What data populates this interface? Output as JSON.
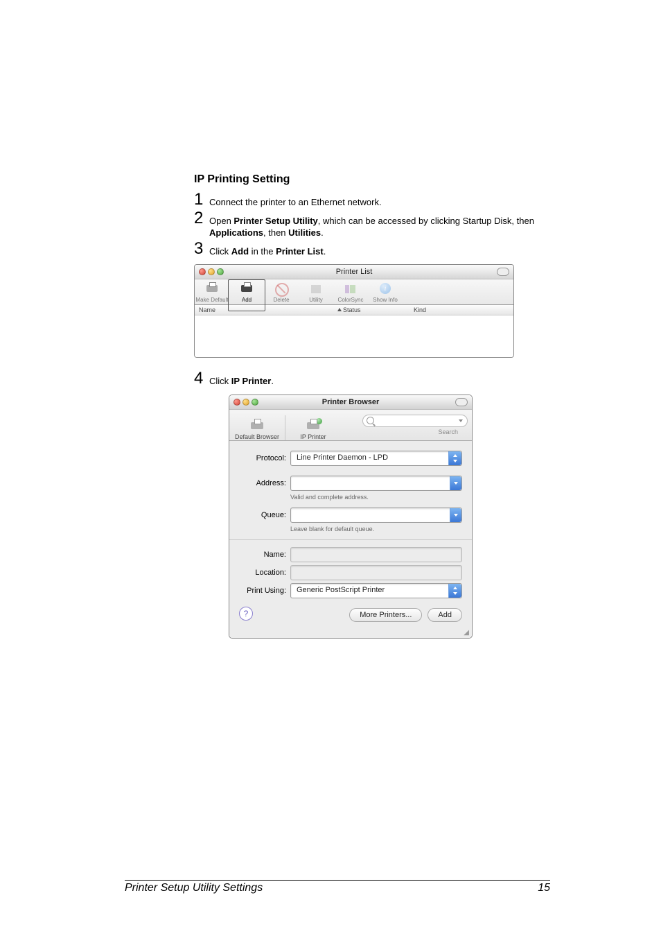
{
  "section_heading": "IP Printing Setting",
  "steps": {
    "s1": {
      "num": "1",
      "text": "Connect the printer to an Ethernet network."
    },
    "s2": {
      "num": "2",
      "prefix": "Open ",
      "b1": "Printer Setup Utility",
      "mid1": ", which can be accessed by clicking Startup Disk, then ",
      "b2": "Applications",
      "mid2": ", then ",
      "b3": "Utilities",
      "suffix": "."
    },
    "s3": {
      "num": "3",
      "prefix": "Click ",
      "b1": "Add",
      "mid1": " in the ",
      "b2": "Printer List",
      "suffix": "."
    },
    "s4": {
      "num": "4",
      "prefix": "Click ",
      "b1": "IP Printer",
      "suffix": "."
    }
  },
  "printer_list": {
    "title": "Printer List",
    "tools": {
      "make_default": "Make Default",
      "add": "Add",
      "delete": "Delete",
      "utility": "Utility",
      "colorsync": "ColorSync",
      "show_info": "Show Info"
    },
    "columns": {
      "name": "Name",
      "status": "Status",
      "kind": "Kind"
    }
  },
  "browser": {
    "title": "Printer Browser",
    "tabs": {
      "default": "Default Browser",
      "ip": "IP Printer"
    },
    "search_label": "Search",
    "fields": {
      "protocol_label": "Protocol:",
      "protocol_value": "Line Printer Daemon - LPD",
      "address_label": "Address:",
      "address_hint": "Valid and complete address.",
      "queue_label": "Queue:",
      "queue_hint": "Leave blank for default queue.",
      "name_label": "Name:",
      "location_label": "Location:",
      "print_using_label": "Print Using:",
      "print_using_value": "Generic PostScript Printer"
    },
    "help": "?",
    "more_btn": "More Printers...",
    "add_btn": "Add"
  },
  "footer": {
    "left": "Printer Setup Utility Settings",
    "right": "15"
  }
}
